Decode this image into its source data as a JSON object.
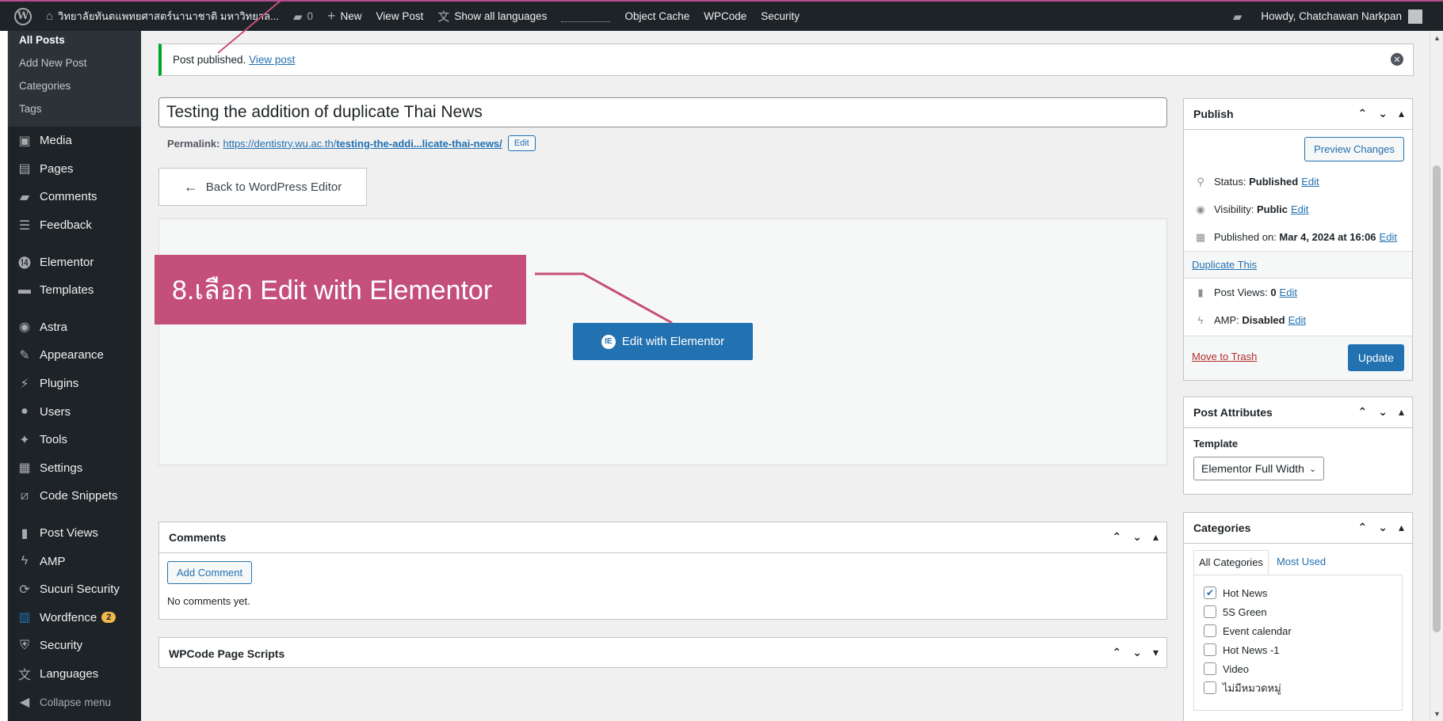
{
  "adminbar": {
    "site_name": "วิทยาลัยทันตแพทยศาสตร์นานาชาติ มหาวิทยาล...",
    "comments_count": "0",
    "new_label": "New",
    "view_post_label": "View Post",
    "languages_label": "Show all languages",
    "object_cache_label": "Object Cache",
    "wpcode_label": "WPCode",
    "security_label": "Security",
    "howdy_label": "Howdy, Chatchawan Narkpan"
  },
  "sidebar": {
    "posts_sub": [
      "All Posts",
      "Add New Post",
      "Categories",
      "Tags"
    ],
    "items": [
      {
        "label": "Media",
        "icon": "media-icon"
      },
      {
        "label": "Pages",
        "icon": "pages-icon"
      },
      {
        "label": "Comments",
        "icon": "comments-icon"
      },
      {
        "label": "Feedback",
        "icon": "feedback-icon"
      },
      {
        "label": "Elementor",
        "icon": "elementor-icon"
      },
      {
        "label": "Templates",
        "icon": "templates-icon"
      },
      {
        "label": "Astra",
        "icon": "astra-icon"
      },
      {
        "label": "Appearance",
        "icon": "appearance-icon"
      },
      {
        "label": "Plugins",
        "icon": "plugins-icon"
      },
      {
        "label": "Users",
        "icon": "users-icon"
      },
      {
        "label": "Tools",
        "icon": "tools-icon"
      },
      {
        "label": "Settings",
        "icon": "settings-icon"
      },
      {
        "label": "Code Snippets",
        "icon": "code-snippets-icon"
      },
      {
        "label": "Post Views",
        "icon": "post-views-icon"
      },
      {
        "label": "AMP",
        "icon": "amp-icon"
      },
      {
        "label": "Sucuri Security",
        "icon": "sucuri-icon"
      },
      {
        "label": "Wordfence",
        "icon": "wordfence-icon",
        "badge": "2"
      },
      {
        "label": "Security",
        "icon": "security-icon"
      },
      {
        "label": "Languages",
        "icon": "languages-icon"
      }
    ],
    "collapse_label": "Collapse menu"
  },
  "notice": {
    "text": "Post published.",
    "link": "View post"
  },
  "editor": {
    "title": "Testing the addition of duplicate Thai News",
    "permalink_label": "Permalink:",
    "permalink_base": "https://dentistry.wu.ac.th/",
    "permalink_slug": "testing-the-addi...licate-thai-news/",
    "permalink_edit": "Edit",
    "back_button": "Back to WordPress Editor",
    "edit_elementor": "Edit with Elementor",
    "callout": "8.เลือก Edit with Elementor"
  },
  "comments_box": {
    "title": "Comments",
    "add_button": "Add Comment",
    "empty_text": "No comments yet."
  },
  "wpcode_box": {
    "title": "WPCode Page Scripts"
  },
  "publish": {
    "title": "Publish",
    "preview_button": "Preview Changes",
    "status_label": "Status:",
    "status_value": "Published",
    "visibility_label": "Visibility:",
    "visibility_value": "Public",
    "published_label": "Published on:",
    "published_value": "Mar 4, 2024 at 16:06",
    "edit": "Edit",
    "duplicate": "Duplicate This",
    "views_label": "Post Views:",
    "views_value": "0",
    "amp_label": "AMP:",
    "amp_value": "Disabled",
    "trash": "Move to Trash",
    "update": "Update"
  },
  "attributes": {
    "title": "Post Attributes",
    "template_label": "Template",
    "template_value": "Elementor Full Width"
  },
  "categories": {
    "title": "Categories",
    "tab_all": "All Categories",
    "tab_used": "Most Used",
    "items": [
      {
        "label": "Hot News",
        "checked": true
      },
      {
        "label": "5S Green",
        "checked": false
      },
      {
        "label": "Event calendar",
        "checked": false
      },
      {
        "label": "Hot News -1",
        "checked": false
      },
      {
        "label": "Video",
        "checked": false
      },
      {
        "label": "ไม่มีหมวดหมู่",
        "checked": false
      }
    ]
  },
  "colors": {
    "adminbar_bg": "#1d2327",
    "accent": "#2271b1",
    "callout": "#c44f7a",
    "notice_success": "#00a32a",
    "badge": "#f0b849"
  }
}
